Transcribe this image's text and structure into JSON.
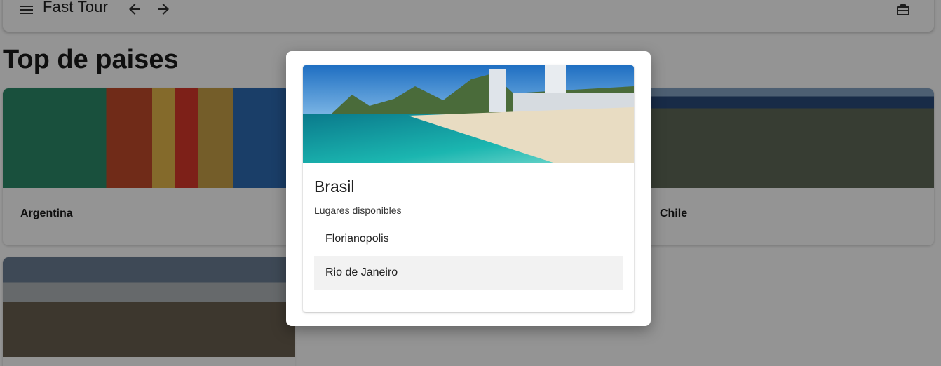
{
  "appbar": {
    "title": "Fast Tour",
    "icons": [
      "menu-icon",
      "arrow-back-icon",
      "arrow-forward-icon",
      "briefcase-icon"
    ]
  },
  "section": {
    "title": "Top de paises"
  },
  "countries": [
    {
      "name": "Argentina"
    },
    {
      "name": "Chile"
    },
    {
      "name": ""
    }
  ],
  "modal": {
    "country": "Brasil",
    "subtitle": "Lugares disponibles",
    "places": [
      "Florianopolis",
      "Rio de Janeiro"
    ]
  },
  "colors": {
    "overlay": "rgba(0,0,0,0.42)",
    "selected_item_bg": "#f2f2f2"
  }
}
